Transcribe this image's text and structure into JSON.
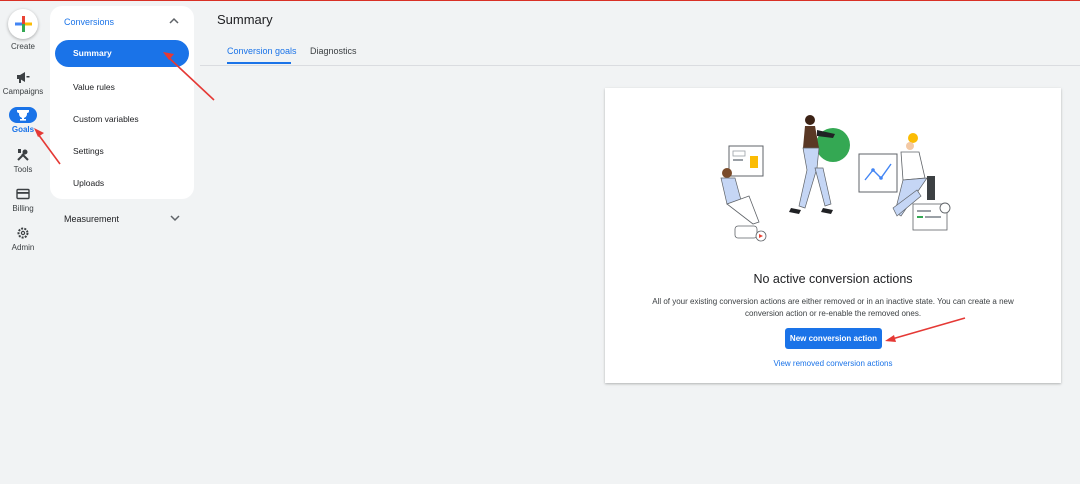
{
  "rail": {
    "create_label": "Create",
    "items": [
      {
        "label": "Campaigns",
        "icon": "megaphone-icon"
      },
      {
        "label": "Goals",
        "icon": "trophy-icon"
      },
      {
        "label": "Tools",
        "icon": "tools-icon"
      },
      {
        "label": "Billing",
        "icon": "credit-card-icon"
      },
      {
        "label": "Admin",
        "icon": "gear-icon"
      }
    ]
  },
  "subnav": {
    "header": "Conversions",
    "items": [
      "Summary",
      "Value rules",
      "Custom variables",
      "Settings",
      "Uploads"
    ],
    "selected": "Summary",
    "measurement": "Measurement"
  },
  "page": {
    "title": "Summary",
    "tabs": [
      "Conversion goals",
      "Diagnostics"
    ],
    "active_tab": "Conversion goals"
  },
  "empty_state": {
    "title": "No active conversion actions",
    "description": "All of your existing conversion actions are either removed or in an inactive state. You can create a new conversion action or re-enable the removed ones.",
    "primary_button": "New conversion action",
    "link": "View removed conversion actions"
  },
  "colors": {
    "accent": "#1a73e8",
    "annotation": "#e53935",
    "background": "#f1f3f4"
  }
}
